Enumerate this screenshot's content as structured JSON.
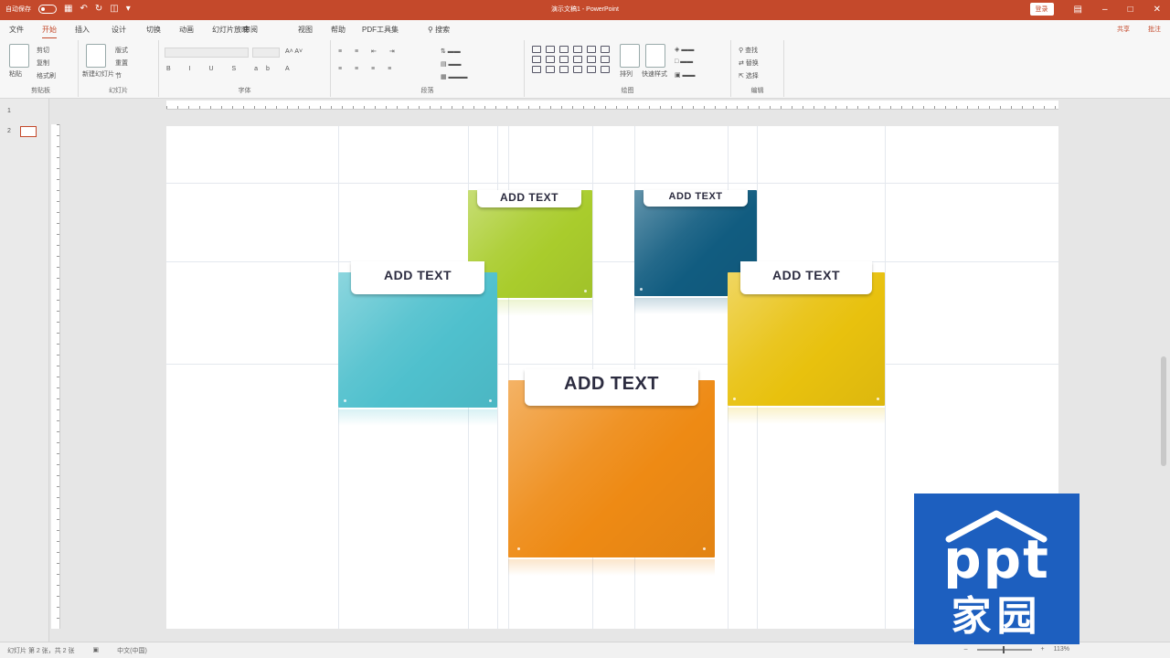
{
  "titlebar": {
    "autosave": "自动保存",
    "title": "演示文稿1 - PowerPoint",
    "signin": "登录"
  },
  "tabs": [
    "文件",
    "开始",
    "插入",
    "设计",
    "切换",
    "动画",
    "幻灯片放映",
    "审阅",
    "视图",
    "帮助",
    "PDF工具集",
    "搜索"
  ],
  "ribbon_right": [
    "共享",
    "批注"
  ],
  "ribbon_groups": [
    "剪贴板",
    "幻灯片",
    "字体",
    "段落",
    "绘图",
    "编辑"
  ],
  "ribbon_items": {
    "paste": "粘贴",
    "cut": "剪切",
    "copy": "复制",
    "format_painter": "格式刷",
    "new_slide": "新建幻灯片",
    "layout": "版式",
    "reset": "重置",
    "section": "节",
    "arrange": "排列",
    "quick_styles": "快速样式",
    "find": "查找",
    "replace": "替换",
    "select": "选择"
  },
  "thumbnails": [
    "1",
    "2"
  ],
  "cards": [
    {
      "label": "ADD TEXT",
      "color": "#a9cc2c"
    },
    {
      "label": "ADD TEXT",
      "color": "#115c80"
    },
    {
      "label": "ADD TEXT",
      "color": "#4fc0cd"
    },
    {
      "label": "ADD TEXT",
      "color": "#e8c10e"
    },
    {
      "label": "ADD TEXT",
      "color": "#ee8a14"
    }
  ],
  "statusbar": {
    "slide_info": "幻灯片 第 2 张，共 2 张",
    "language": "中文(中国)",
    "zoom": "113%"
  },
  "logo": {
    "line1": "ppt",
    "line2": "家园",
    "color": "#1d5fbf"
  }
}
